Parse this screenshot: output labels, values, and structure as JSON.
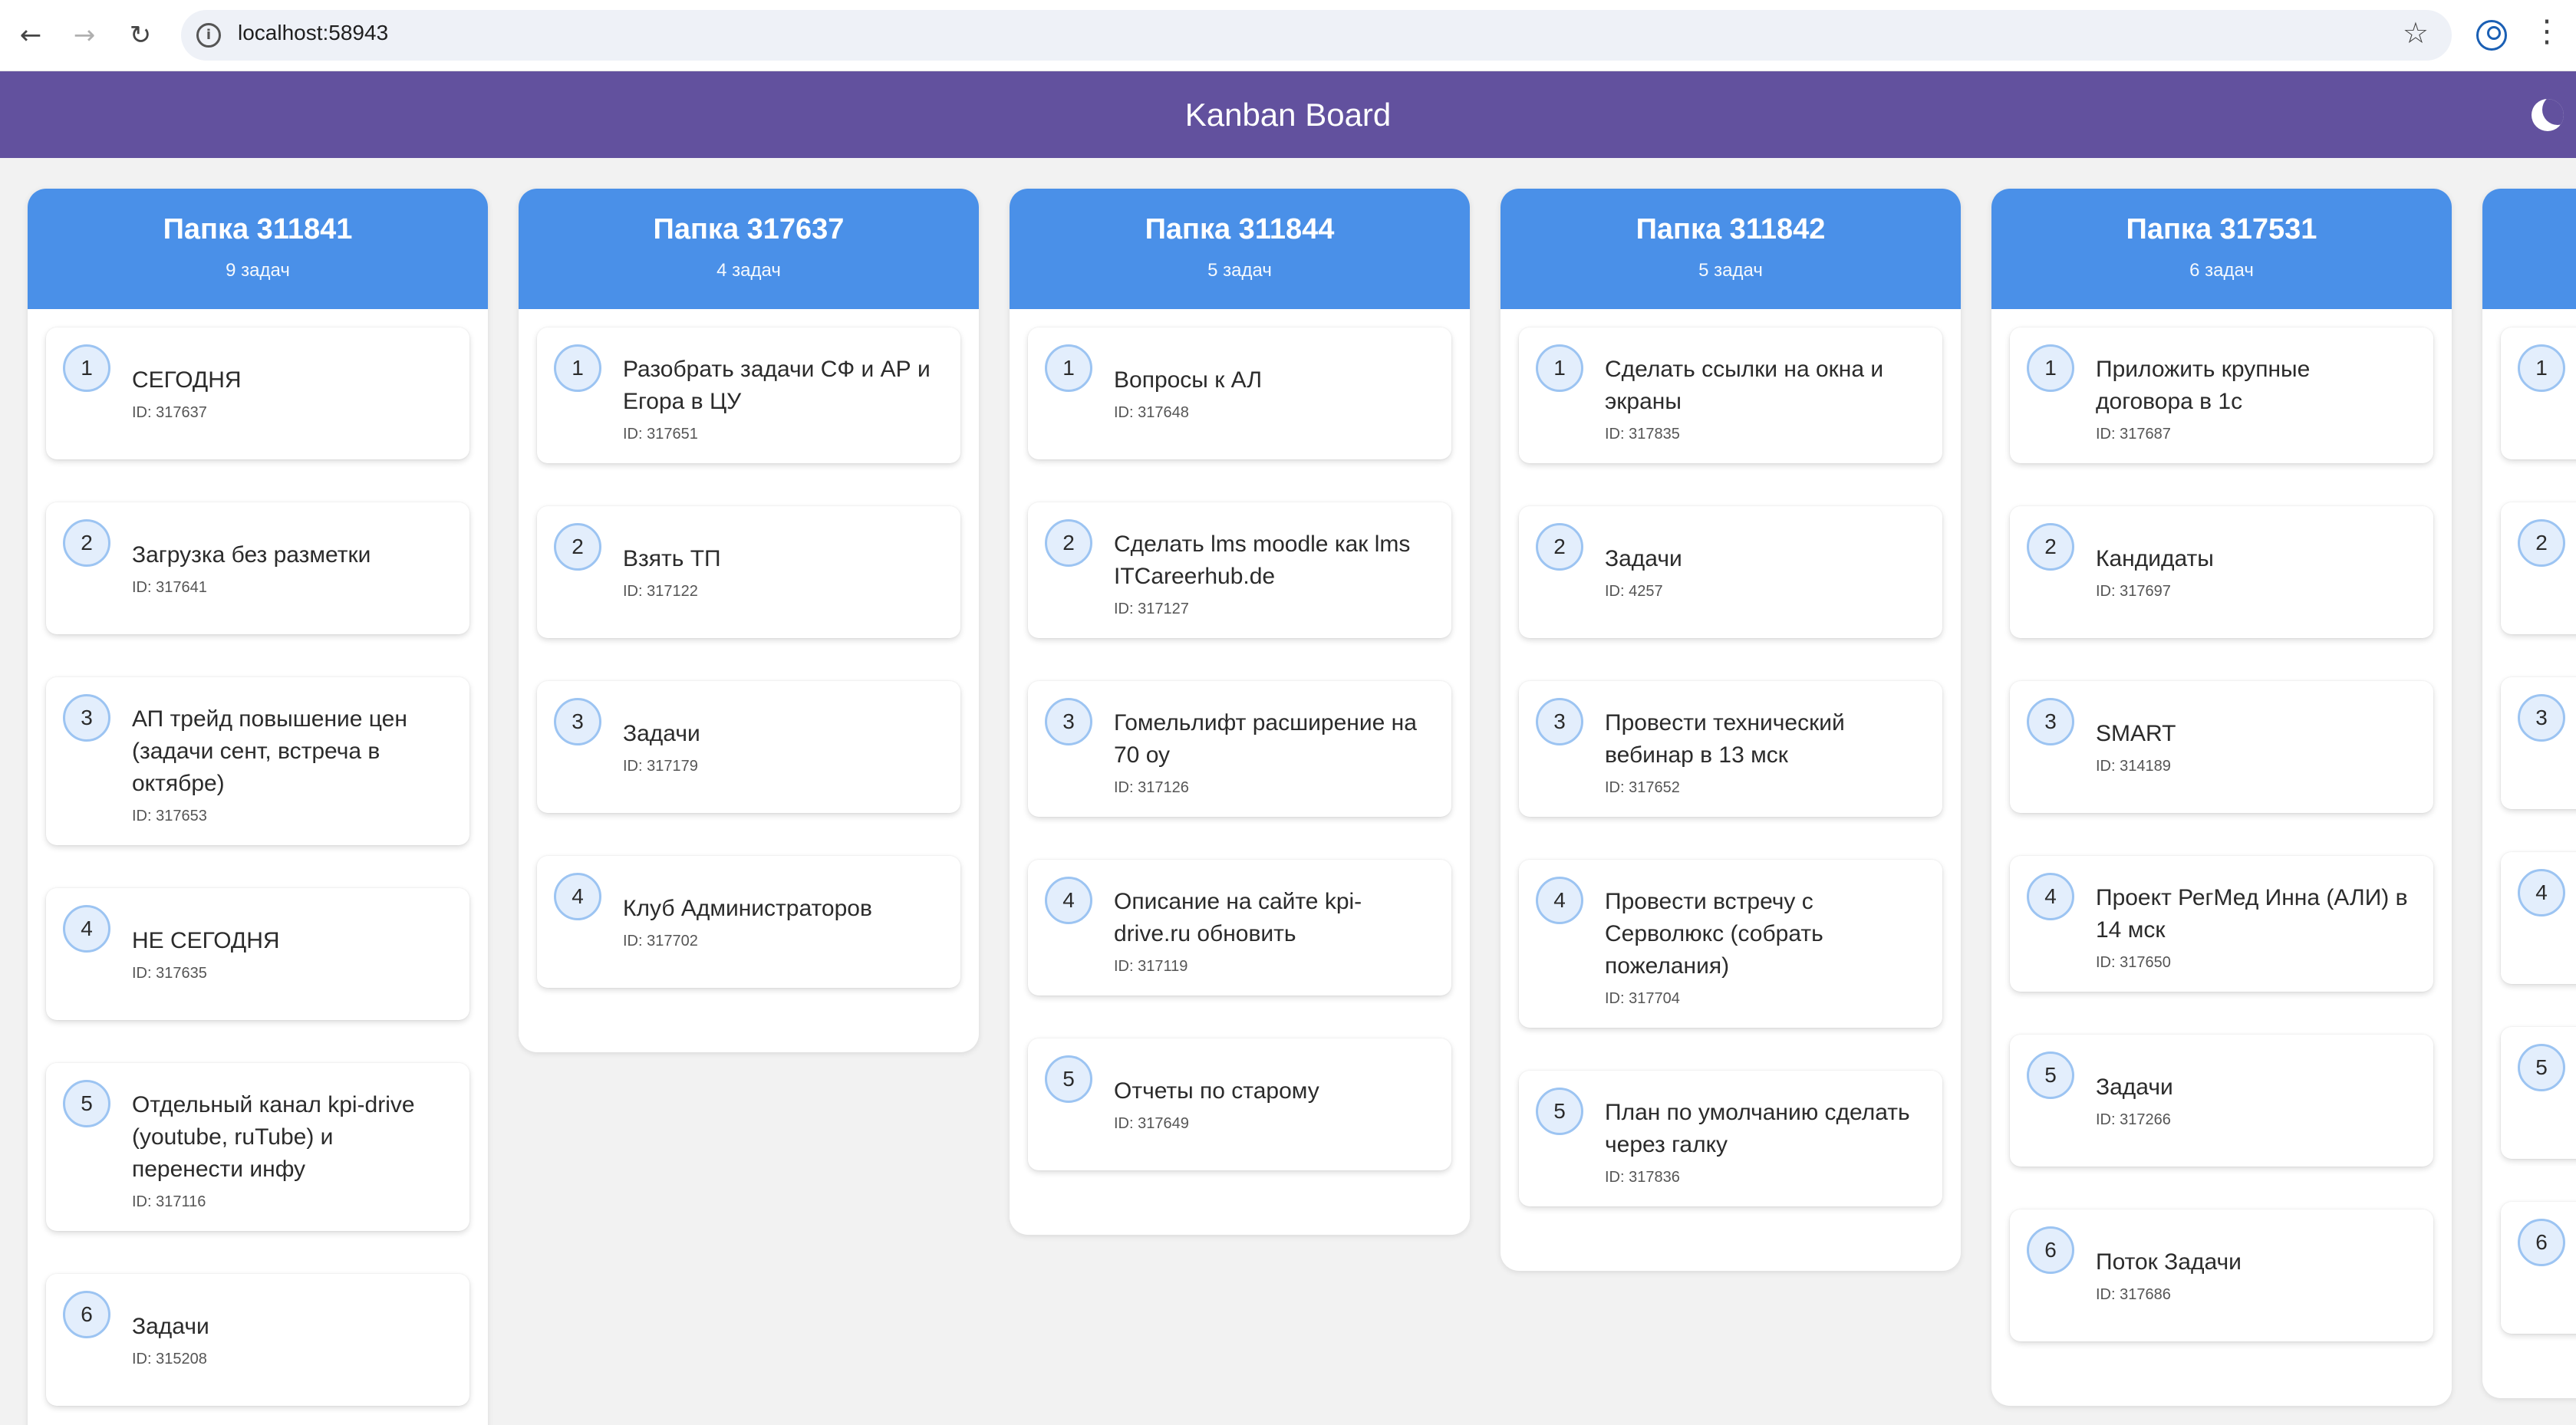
{
  "browser": {
    "url": "localhost:58943",
    "back_icon": "arrow-left-icon",
    "forward_icon": "arrow-right-icon",
    "reload_icon": "reload-icon"
  },
  "app": {
    "title": "Kanban Board",
    "theme_icon": "moon-icon",
    "colors": {
      "header": "#62519e",
      "column_header": "#4a90e8"
    }
  },
  "columns": [
    {
      "title": "Папка 311841",
      "count": "9 задач",
      "tasks": [
        {
          "num": "1",
          "title": "СЕГОДНЯ",
          "id": "ID: 317637"
        },
        {
          "num": "2",
          "title": "Загрузка без разметки",
          "id": "ID: 317641"
        },
        {
          "num": "3",
          "title": "АП трейд повышение цен (задачи сент, встреча в октябре)",
          "id": "ID: 317653"
        },
        {
          "num": "4",
          "title": "НЕ СЕГОДНЯ",
          "id": "ID: 317635"
        },
        {
          "num": "5",
          "title": "Отдельный канал kpi-drive (youtube, ruTube) и перенести инфу",
          "id": "ID: 317116"
        },
        {
          "num": "6",
          "title": "Задачи",
          "id": "ID: 315208"
        }
      ]
    },
    {
      "title": "Папка 317637",
      "count": "4 задач",
      "tasks": [
        {
          "num": "1",
          "title": "Разобрать задачи СФ и АР и Егора в ЦУ",
          "id": "ID: 317651"
        },
        {
          "num": "2",
          "title": "Взять ТП",
          "id": "ID: 317122"
        },
        {
          "num": "3",
          "title": "Задачи",
          "id": "ID: 317179"
        },
        {
          "num": "4",
          "title": "Клуб Администраторов",
          "id": "ID: 317702"
        }
      ]
    },
    {
      "title": "Папка 311844",
      "count": "5 задач",
      "tasks": [
        {
          "num": "1",
          "title": "Вопросы к АЛ",
          "id": "ID: 317648"
        },
        {
          "num": "2",
          "title": "Сделать lms moodle как lms ITCareerhub.de",
          "id": "ID: 317127"
        },
        {
          "num": "3",
          "title": "Гомельлифт расширение на 70 оу",
          "id": "ID: 317126"
        },
        {
          "num": "4",
          "title": "Описание на сайте kpi-drive.ru обновить",
          "id": "ID: 317119"
        },
        {
          "num": "5",
          "title": "Отчеты по старому",
          "id": "ID: 317649"
        }
      ]
    },
    {
      "title": "Папка 311842",
      "count": "5 задач",
      "tasks": [
        {
          "num": "1",
          "title": "Сделать ссылки на окна и экраны",
          "id": "ID: 317835"
        },
        {
          "num": "2",
          "title": "Задачи",
          "id": "ID: 4257"
        },
        {
          "num": "3",
          "title": "Провести технический вебинар в 13 мск",
          "id": "ID: 317652"
        },
        {
          "num": "4",
          "title": "Провести встречу с Серволюкс (собрать пожелания)",
          "id": "ID: 317704"
        },
        {
          "num": "5",
          "title": "План по умолчанию сделать через галку",
          "id": "ID: 317836"
        }
      ]
    },
    {
      "title": "Папка 317531",
      "count": "6 задач",
      "tasks": [
        {
          "num": "1",
          "title": "Приложить крупные договора в 1с",
          "id": "ID: 317687"
        },
        {
          "num": "2",
          "title": "Кандидаты",
          "id": "ID: 317697"
        },
        {
          "num": "3",
          "title": "SMART",
          "id": "ID: 314189"
        },
        {
          "num": "4",
          "title": "Проект РегМед Инна (АЛИ) в 14 мск",
          "id": "ID: 317650"
        },
        {
          "num": "5",
          "title": "Задачи",
          "id": "ID: 317266"
        },
        {
          "num": "6",
          "title": "Поток Задачи",
          "id": "ID: 317686"
        }
      ]
    },
    {
      "title": "",
      "count": "",
      "tasks": [
        {
          "num": "1",
          "title": "",
          "id": ""
        },
        {
          "num": "2",
          "title": "",
          "id": ""
        },
        {
          "num": "3",
          "title": "",
          "id": ""
        },
        {
          "num": "4",
          "title": "",
          "id": ""
        },
        {
          "num": "5",
          "title": "",
          "id": ""
        },
        {
          "num": "6",
          "title": "",
          "id": ""
        }
      ]
    }
  ]
}
